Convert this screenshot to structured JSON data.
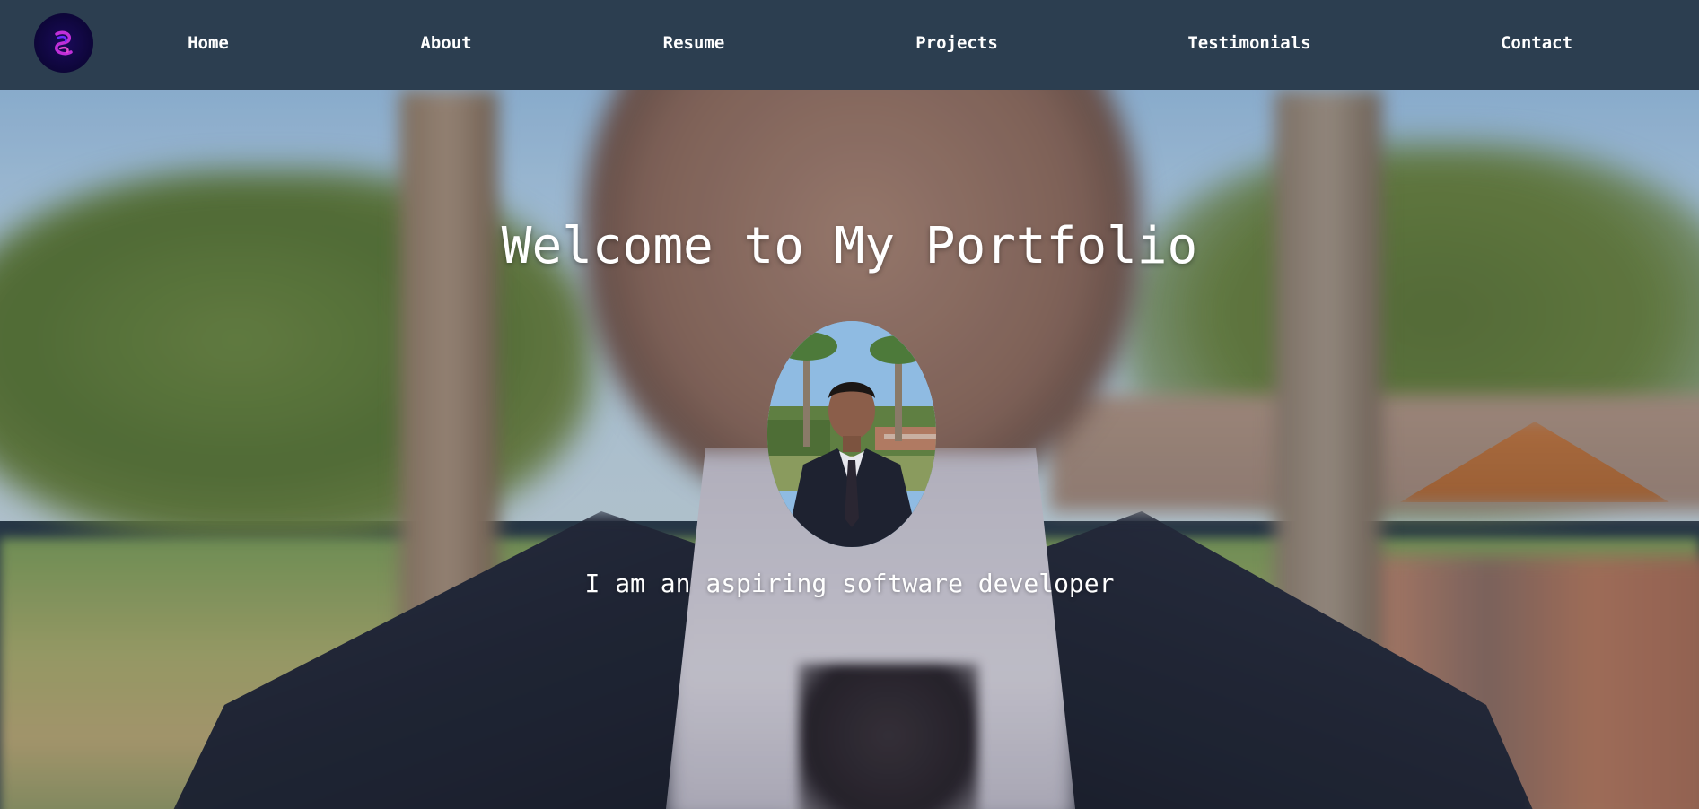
{
  "nav": {
    "logo_icon": "logo-icon",
    "items": [
      {
        "label": "Home"
      },
      {
        "label": "About"
      },
      {
        "label": "Resume"
      },
      {
        "label": "Projects"
      },
      {
        "label": "Testimonials"
      },
      {
        "label": "Contact"
      }
    ]
  },
  "hero": {
    "title": "Welcome to My Portfolio",
    "subtitle": "I am an aspiring software developer",
    "profile_image": "profile-photo"
  },
  "colors": {
    "navbar": "#2c3e50",
    "nav_text": "#ffffff",
    "logo_bg": "#0d0638",
    "logo_accent": "#c02fd8"
  }
}
